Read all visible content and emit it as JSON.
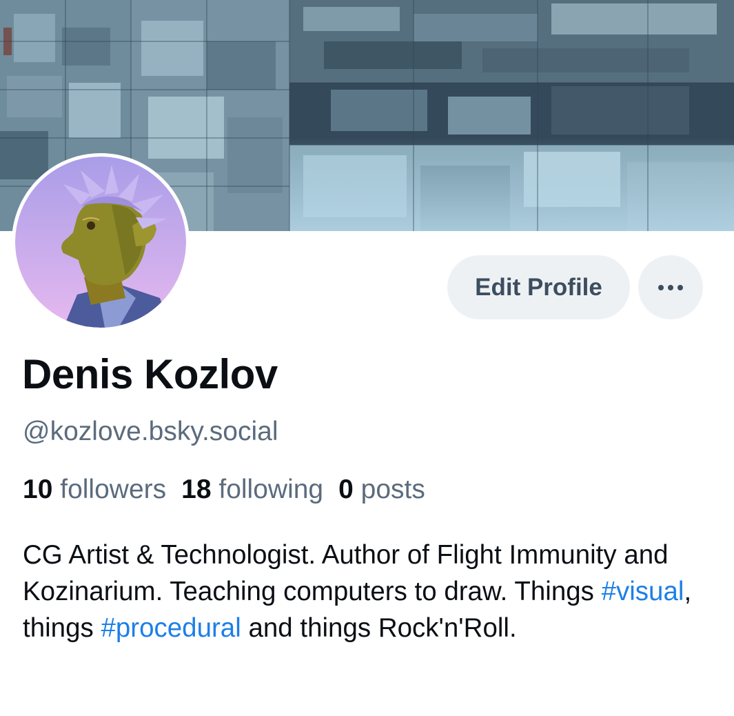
{
  "header": {
    "banner_image": "cg-render-cube-cavern",
    "avatar_image": "cg-character-portrait"
  },
  "actions": {
    "edit_profile_label": "Edit Profile",
    "more_icon": "more-horizontal-icon"
  },
  "profile": {
    "display_name": "Denis Kozlov",
    "handle": "@kozlove.bsky.social"
  },
  "stats": {
    "followers_count": "10",
    "followers_label": "followers",
    "following_count": "18",
    "following_label": "following",
    "posts_count": "0",
    "posts_label": "posts"
  },
  "bio": {
    "text_1": "CG Artist & Technologist. Author of Flight Immunity and Kozinarium. Teaching computers to draw. Things ",
    "hashtag_1": "#visual",
    "text_2": ", things ",
    "hashtag_2": "#procedural",
    "text_3": " and things Rock'n'Roll."
  },
  "colors": {
    "link": "#1d7fe8",
    "muted_text": "#5b6b7d",
    "button_bg": "#eef1f4",
    "button_text": "#3c4d5f",
    "primary_text": "#0b0f14"
  }
}
